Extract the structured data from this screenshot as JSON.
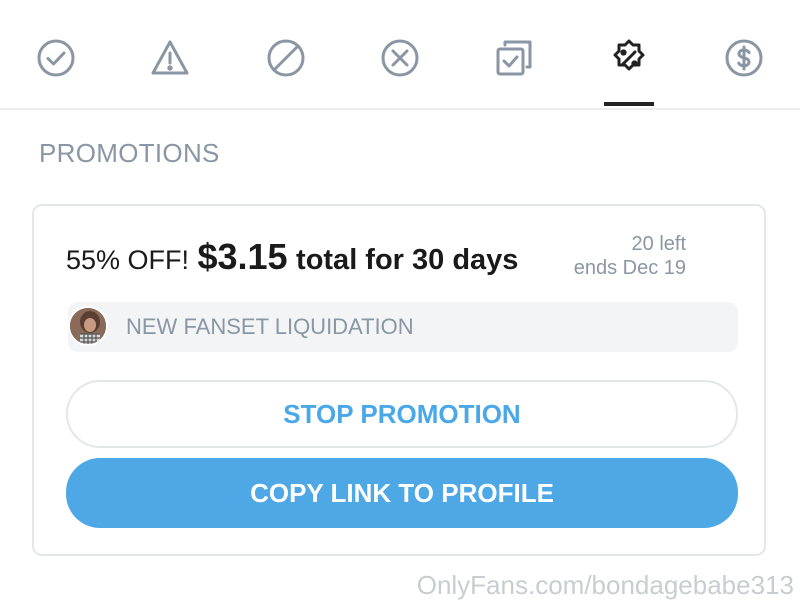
{
  "tabs": [
    {
      "icon": "check-circle-icon"
    },
    {
      "icon": "warning-triangle-icon"
    },
    {
      "icon": "prohibited-icon"
    },
    {
      "icon": "x-circle-icon"
    },
    {
      "icon": "copy-check-icon"
    },
    {
      "icon": "percent-badge-icon",
      "active": true
    },
    {
      "icon": "dollar-circle-icon"
    }
  ],
  "section": {
    "title": "PROMOTIONS"
  },
  "promotion": {
    "discount": "55% OFF!",
    "price": "$3.15",
    "terms": "total for 30 days",
    "remaining": "20 left",
    "ends": "ends Dec 19",
    "message": "NEW FANSET LIQUIDATION",
    "stop_label": "STOP PROMOTION",
    "copy_label": "COPY LINK TO PROFILE"
  },
  "watermark": "OnlyFans.com/bondagebabe313",
  "colors": {
    "accent": "#4ea8e6",
    "muted": "#8a96a3",
    "active_tab": "#222222"
  }
}
